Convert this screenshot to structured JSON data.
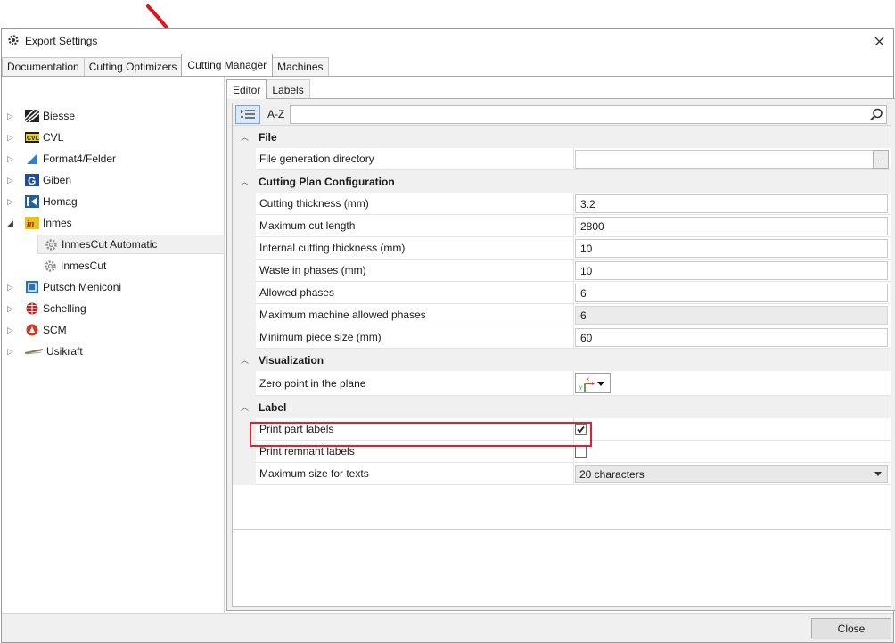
{
  "window": {
    "title": "Export Settings"
  },
  "main_tabs": [
    {
      "label": "Documentation",
      "active": false
    },
    {
      "label": "Cutting Optimizers",
      "active": false
    },
    {
      "label": "Cutting Manager",
      "active": true
    },
    {
      "label": "Machines",
      "active": false
    }
  ],
  "tree": [
    {
      "label": "Biesse",
      "icon": "biesse-logo-icon",
      "expander": "collapsed"
    },
    {
      "label": "CVL",
      "icon": "cvl-logo-icon",
      "expander": "collapsed"
    },
    {
      "label": "Format4/Felder",
      "icon": "format4-logo-icon",
      "expander": "collapsed"
    },
    {
      "label": "Giben",
      "icon": "giben-logo-icon",
      "expander": "collapsed"
    },
    {
      "label": "Homag",
      "icon": "homag-logo-icon",
      "expander": "collapsed"
    },
    {
      "label": "Inmes",
      "icon": "inmes-logo-icon",
      "expander": "expanded"
    },
    {
      "label": "InmesCut Automatic",
      "icon": "gear-icon",
      "child": true,
      "selected": true
    },
    {
      "label": "InmesCut",
      "icon": "gear-icon",
      "child": true
    },
    {
      "label": "Putsch Meniconi",
      "icon": "putsch-meniconi-logo-icon",
      "expander": "collapsed"
    },
    {
      "label": "Schelling",
      "icon": "schelling-logo-icon",
      "expander": "collapsed"
    },
    {
      "label": "SCM",
      "icon": "scm-logo-icon",
      "expander": "collapsed"
    },
    {
      "label": "Usikraft",
      "icon": "usikraft-logo-icon",
      "expander": "collapsed"
    }
  ],
  "sub_tabs": [
    {
      "label": "Editor",
      "active": true
    },
    {
      "label": "Labels",
      "active": false
    }
  ],
  "toolbar": {
    "categorized_label": "",
    "alphabetical_label": "A-Z",
    "search_placeholder": ""
  },
  "sections": {
    "file": {
      "title": "File",
      "rows": [
        {
          "name": "File generation directory",
          "value": "",
          "browse_label": "..."
        }
      ]
    },
    "cutting": {
      "title": "Cutting Plan Configuration",
      "rows": [
        {
          "name": "Cutting thickness (mm)",
          "value": "3.2"
        },
        {
          "name": "Maximum cut length",
          "value": "2800"
        },
        {
          "name": "Internal cutting thickness (mm)",
          "value": "10"
        },
        {
          "name": "Waste in phases (mm)",
          "value": "10"
        },
        {
          "name": "Allowed phases",
          "value": "6"
        },
        {
          "name": "Maximum machine allowed phases",
          "value": "6",
          "disabled": true
        },
        {
          "name": "Minimum piece size (mm)",
          "value": "60"
        }
      ]
    },
    "visualization": {
      "title": "Visualization",
      "rows": [
        {
          "name": "Zero point in the plane",
          "value_icon": "axes-origin-icon"
        }
      ]
    },
    "label": {
      "title": "Label",
      "rows": [
        {
          "name": "Print part labels",
          "checked": true
        },
        {
          "name": "Print remnant labels",
          "checked": false
        },
        {
          "name": "Maximum size for texts",
          "value": "20 characters"
        }
      ]
    }
  },
  "footer": {
    "close_label": "Close"
  },
  "colors": {
    "highlight": "#e0202a",
    "annotation_arrow": "#e8101c"
  }
}
